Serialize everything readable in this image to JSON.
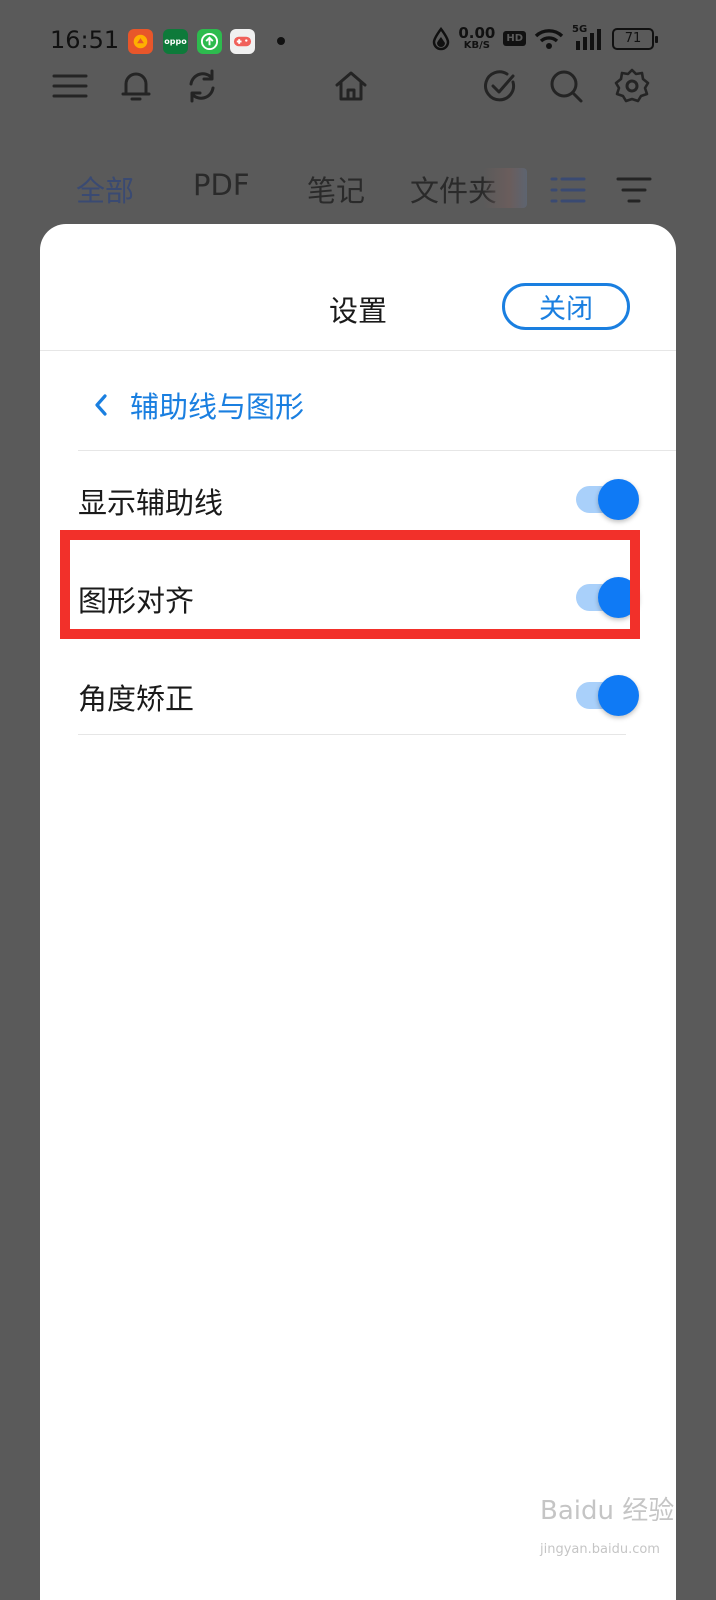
{
  "status_bar": {
    "time": "16:51",
    "notification_icons": [
      {
        "name": "app-icon-orange",
        "color": "#e8562a",
        "label": ""
      },
      {
        "name": "oppo-app-icon",
        "color": "#0e7a3a",
        "label": "oppo"
      },
      {
        "name": "upload-app-icon",
        "color": "#2dbb4e",
        "label": "↑"
      },
      {
        "name": "game-app-icon",
        "color": "#f0f0f0",
        "label": ""
      }
    ],
    "net_speed_value": "0.00",
    "net_speed_unit": "KB/S",
    "hd_badge": "HD",
    "network_label": "5G",
    "battery": "71"
  },
  "toolbar": {
    "icons": [
      "menu-icon",
      "bell-icon",
      "sync-icon",
      "home-icon",
      "check-circle-icon",
      "search-icon",
      "settings-gear-icon"
    ]
  },
  "tabs": [
    {
      "label": "全部",
      "active": true
    },
    {
      "label": "PDF",
      "active": false
    },
    {
      "label": "笔记",
      "active": false
    },
    {
      "label": "文件夹",
      "active": false
    }
  ],
  "sheet": {
    "title": "设置",
    "close_label": "关闭",
    "back_title": "辅助线与图形",
    "settings": [
      {
        "label": "显示辅助线",
        "enabled": true
      },
      {
        "label": "图形对齐",
        "enabled": true
      },
      {
        "label": "角度矫正",
        "enabled": true
      }
    ]
  },
  "watermark": {
    "main": "Baidu 经验",
    "sub": "jingyan.baidu.com"
  },
  "colors": {
    "accent": "#1a7fe0",
    "toggle_on": "#0f7af5",
    "highlight": "#f2302a",
    "overlay": "#5a5a5a"
  }
}
